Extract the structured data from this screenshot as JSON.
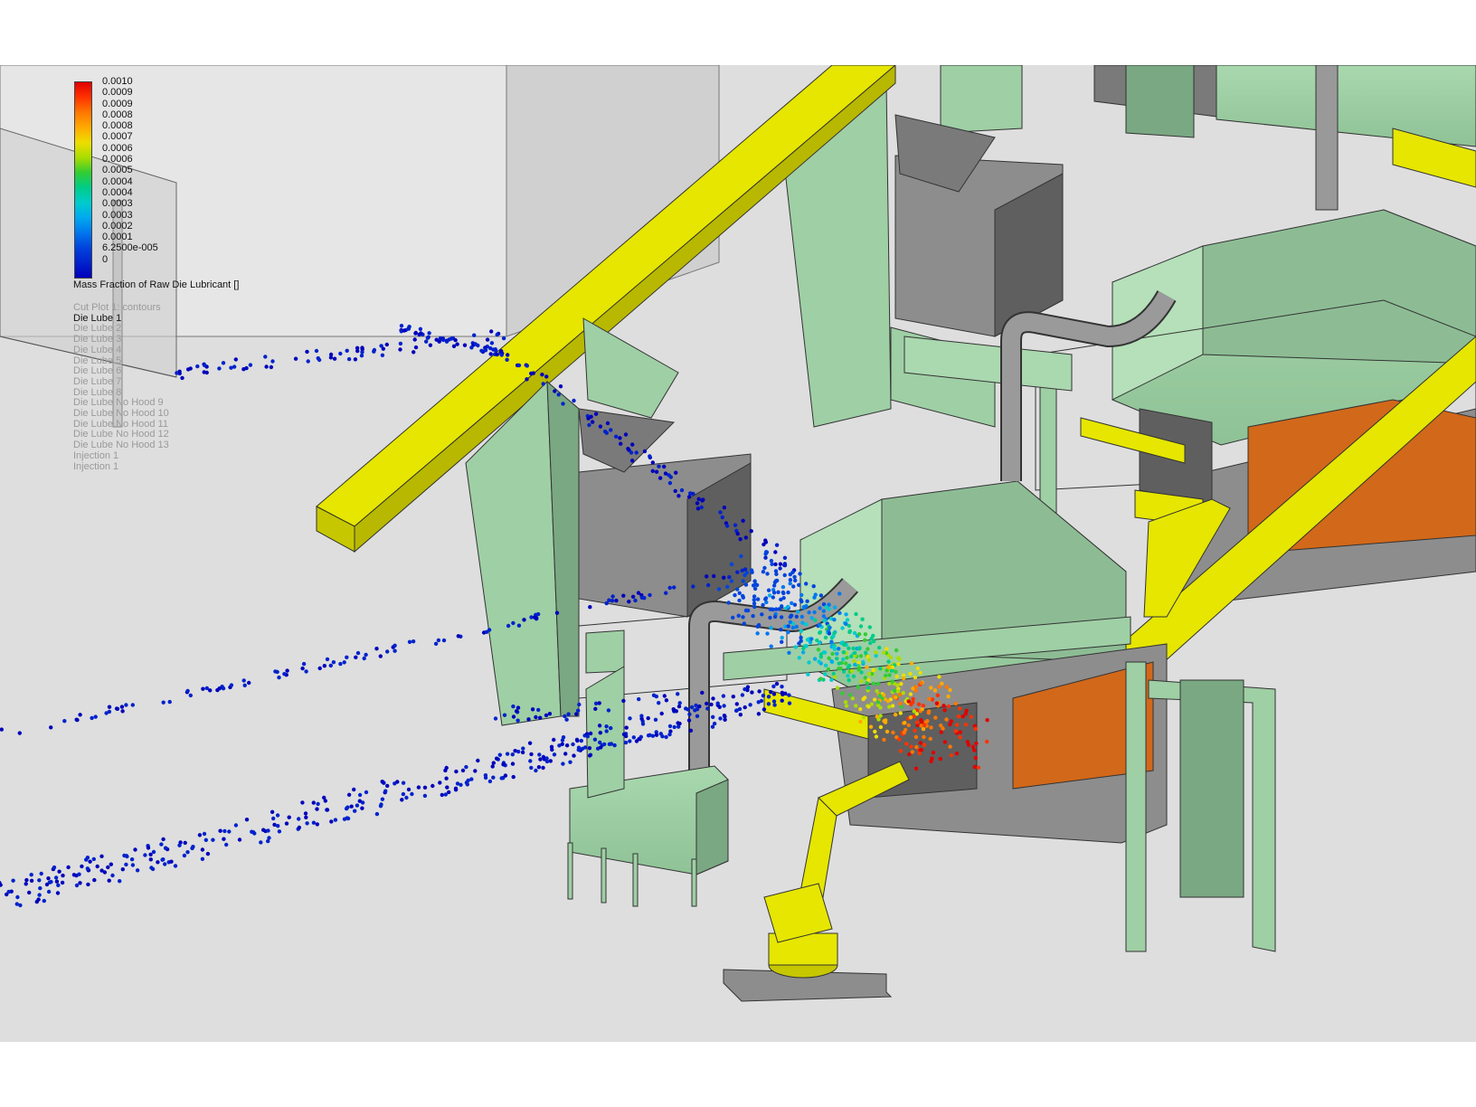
{
  "legend": {
    "title": "Mass Fraction of Raw Die Lubricant []",
    "colors": [
      "#e00000",
      "#ff3300",
      "#ff7700",
      "#ffaa00",
      "#eedd00",
      "#aadd00",
      "#33cc33",
      "#00cc88",
      "#00cccc",
      "#00aaee",
      "#0077ee",
      "#0044dd",
      "#0022cc",
      "#0000bb"
    ],
    "ticks": [
      "0.0010",
      "0.0009",
      "0.0009",
      "0.0008",
      "0.0008",
      "0.0007",
      "0.0006",
      "0.0006",
      "0.0005",
      "0.0004",
      "0.0004",
      "0.0003",
      "0.0003",
      "0.0002",
      "0.0001",
      "6.2500e-005",
      "0"
    ]
  },
  "plots": {
    "items": [
      "Cut Plot 1: contours",
      "Die Lube 1",
      "Die Lube 2",
      "Die Lube 3",
      "Die Lube 4",
      "Die Lube 5",
      "Die Lube 6",
      "Die Lube 7",
      "Die Lube 8",
      "Die Lube No Hood 9",
      "Die Lube No Hood 10",
      "Die Lube No Hood 11",
      "Die Lube No Hood 12",
      "Die Lube No Hood 13",
      "Injection 1",
      "Injection 1"
    ],
    "active_index": 1
  },
  "scene_colors": {
    "background": "#dedede",
    "green": "#9fcfa5",
    "green_dark": "#7aa882",
    "gray": "#8d8d8d",
    "gray_dark": "#5f5f5f",
    "yellow": "#e6e600",
    "orange": "#d2681a",
    "particle_low": "#0a3fc2",
    "particle_high": "#e01010"
  }
}
